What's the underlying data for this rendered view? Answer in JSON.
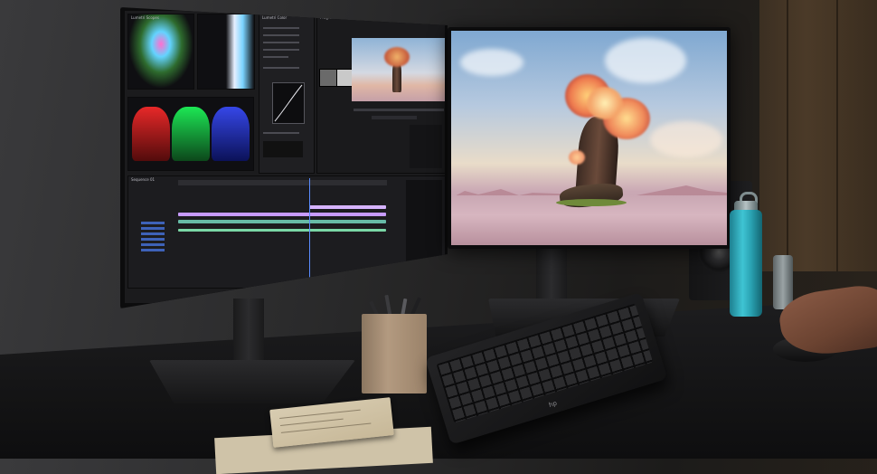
{
  "scene": {
    "description_tags": [],
    "colors": {
      "wall": "#2a2a2b",
      "desk": "#141415",
      "bottle": "#3fc4d3",
      "cup": "#b39a80",
      "scope_red": "#ff2b2b",
      "scope_green": "#1eff5c",
      "scope_blue": "#3a4dff",
      "timeline_purple": "#c79bff"
    }
  },
  "left_monitor": {
    "app_panels": {
      "scopes_title": "Lumetri Scopes",
      "effects_title": "Lumetri Color",
      "program_title": "Program",
      "timeline_title": "Sequence 01"
    }
  },
  "right_monitor": {
    "content": "tree-on-rock-artwork"
  },
  "keyboard": {
    "logo": "hp"
  }
}
